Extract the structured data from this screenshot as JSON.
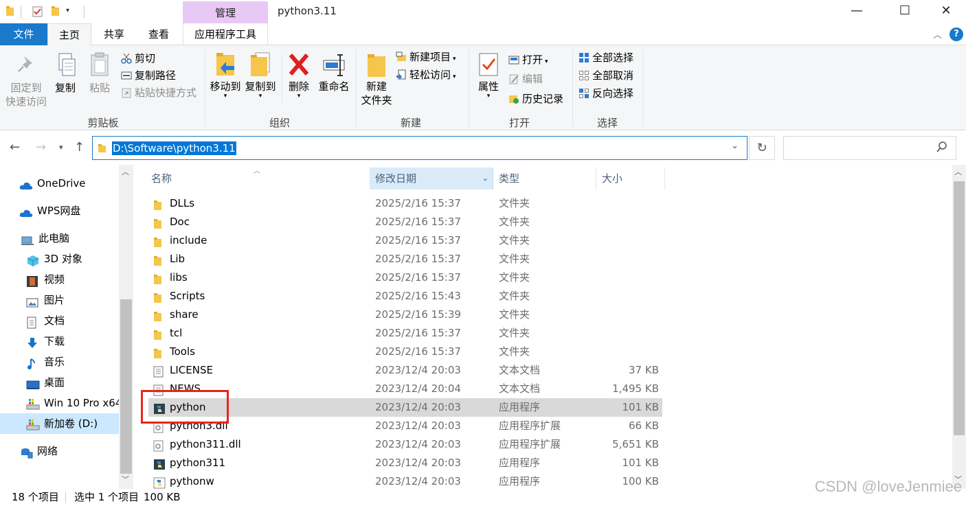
{
  "window": {
    "manage_label": "管理",
    "title": "python3.11",
    "minimize_glyph": "—",
    "maximize_glyph": "☐",
    "close_glyph": "✕"
  },
  "ribbon_tabs": {
    "file": "文件",
    "home": "主页",
    "share": "共享",
    "view": "查看",
    "app_tools": "应用程序工具"
  },
  "clipboard": {
    "pin_line1": "固定到",
    "pin_line2": "快速访问",
    "copy": "复制",
    "paste": "粘贴",
    "cut": "剪切",
    "copy_path": "复制路径",
    "paste_shortcut": "粘贴快捷方式",
    "group": "剪贴板"
  },
  "organize": {
    "move_to": "移动到",
    "copy_to": "复制到",
    "delete": "删除",
    "rename": "重命名",
    "group": "组织"
  },
  "new_group": {
    "new_folder_line1": "新建",
    "new_folder_line2": "文件夹",
    "new_item": "新建项目",
    "easy_access": "轻松访问",
    "group": "新建"
  },
  "open_group": {
    "properties": "属性",
    "open": "打开",
    "edit": "编辑",
    "history": "历史记录",
    "group": "打开"
  },
  "select_group": {
    "select_all": "全部选择",
    "select_none": "全部取消",
    "invert": "反向选择",
    "group": "选择"
  },
  "address": {
    "path": "D:\\Software\\python3.11"
  },
  "nav": {
    "items": [
      {
        "label": "OneDrive",
        "icon": "cloud-icon"
      },
      {
        "label": "WPS网盘",
        "icon": "cloud-icon"
      },
      {
        "label": "此电脑",
        "icon": "computer-icon"
      },
      {
        "label": "3D 对象",
        "icon": "cube-icon"
      },
      {
        "label": "视频",
        "icon": "film-icon"
      },
      {
        "label": "图片",
        "icon": "picture-icon"
      },
      {
        "label": "文档",
        "icon": "document-icon"
      },
      {
        "label": "下载",
        "icon": "download-icon"
      },
      {
        "label": "音乐",
        "icon": "music-icon"
      },
      {
        "label": "桌面",
        "icon": "desktop-icon"
      },
      {
        "label": "Win 10 Pro x64",
        "icon": "drive-icon"
      },
      {
        "label": "新加卷 (D:)",
        "icon": "drive-icon"
      },
      {
        "label": "网络",
        "icon": "network-icon"
      }
    ]
  },
  "columns": {
    "name": "名称",
    "date": "修改日期",
    "type": "类型",
    "size": "大小"
  },
  "files": [
    {
      "name": "DLLs",
      "date": "2025/2/16 15:37",
      "type": "文件夹",
      "size": "",
      "icon": "folder"
    },
    {
      "name": "Doc",
      "date": "2025/2/16 15:37",
      "type": "文件夹",
      "size": "",
      "icon": "folder"
    },
    {
      "name": "include",
      "date": "2025/2/16 15:37",
      "type": "文件夹",
      "size": "",
      "icon": "folder"
    },
    {
      "name": "Lib",
      "date": "2025/2/16 15:37",
      "type": "文件夹",
      "size": "",
      "icon": "folder"
    },
    {
      "name": "libs",
      "date": "2025/2/16 15:37",
      "type": "文件夹",
      "size": "",
      "icon": "folder"
    },
    {
      "name": "Scripts",
      "date": "2025/2/16 15:43",
      "type": "文件夹",
      "size": "",
      "icon": "folder"
    },
    {
      "name": "share",
      "date": "2025/2/16 15:39",
      "type": "文件夹",
      "size": "",
      "icon": "folder"
    },
    {
      "name": "tcl",
      "date": "2025/2/16 15:37",
      "type": "文件夹",
      "size": "",
      "icon": "folder"
    },
    {
      "name": "Tools",
      "date": "2025/2/16 15:37",
      "type": "文件夹",
      "size": "",
      "icon": "folder"
    },
    {
      "name": "LICENSE",
      "date": "2023/12/4 20:03",
      "type": "文本文档",
      "size": "37 KB",
      "icon": "text"
    },
    {
      "name": "NEWS",
      "date": "2023/12/4 20:04",
      "type": "文本文档",
      "size": "1,495 KB",
      "icon": "text"
    },
    {
      "name": "python",
      "date": "2023/12/4 20:03",
      "type": "应用程序",
      "size": "101 KB",
      "icon": "python"
    },
    {
      "name": "python3.dll",
      "date": "2023/12/4 20:03",
      "type": "应用程序扩展",
      "size": "66 KB",
      "icon": "dll"
    },
    {
      "name": "python311.dll",
      "date": "2023/12/4 20:03",
      "type": "应用程序扩展",
      "size": "5,651 KB",
      "icon": "dll"
    },
    {
      "name": "python311",
      "date": "2023/12/4 20:03",
      "type": "应用程序",
      "size": "101 KB",
      "icon": "python"
    },
    {
      "name": "pythonw",
      "date": "2023/12/4 20:03",
      "type": "应用程序",
      "size": "100 KB",
      "icon": "pythonw"
    }
  ],
  "selected_file": "python",
  "status": {
    "count": "18 个项目",
    "selected": "选中 1 个项目",
    "size": "100 KB"
  },
  "watermark": "CSDN @loveJenmiee",
  "colors": {
    "accent": "#1979ca",
    "highlight_box": "#e8241c",
    "manage_tab": "#e8c9f5",
    "folder": "#f5c64b"
  }
}
